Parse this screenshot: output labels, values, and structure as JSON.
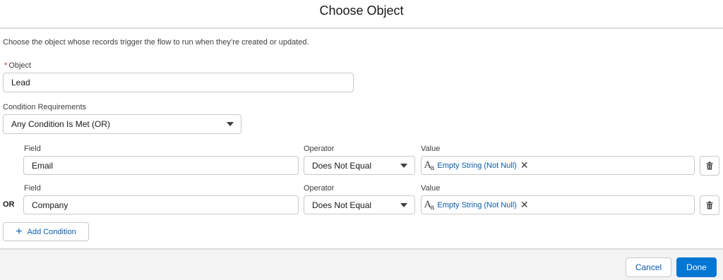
{
  "modal": {
    "title": "Choose Object",
    "description": "Choose the object whose records trigger the flow to run when they’re created or updated."
  },
  "object_field": {
    "required_marker": "*",
    "label": "Object",
    "value": "Lead"
  },
  "condition_requirements": {
    "label": "Condition Requirements",
    "value": "Any Condition Is Met (OR)"
  },
  "conditions": [
    {
      "prefix": "",
      "field_label": "Field",
      "field_value": "Email",
      "operator_label": "Operator",
      "operator_value": "Does Not Equal",
      "value_label": "Value",
      "value_pill": "Empty String (Not Null)"
    },
    {
      "prefix": "OR",
      "field_label": "Field",
      "field_value": "Company",
      "operator_label": "Operator",
      "operator_value": "Does Not Equal",
      "value_label": "Value",
      "value_pill": "Empty String (Not Null)"
    }
  ],
  "add_condition": {
    "label": "Add Condition",
    "icon": "plus-icon"
  },
  "footer": {
    "cancel_label": "Cancel",
    "done_label": "Done"
  },
  "colors": {
    "brand": "#0176d3",
    "link": "#0b5cab",
    "required": "#c23934",
    "footer_bg": "#f3f3f3"
  },
  "icons": [
    "text-type-icon",
    "remove-x-icon",
    "trash-icon",
    "plus-icon",
    "chevron-down-icon"
  ]
}
